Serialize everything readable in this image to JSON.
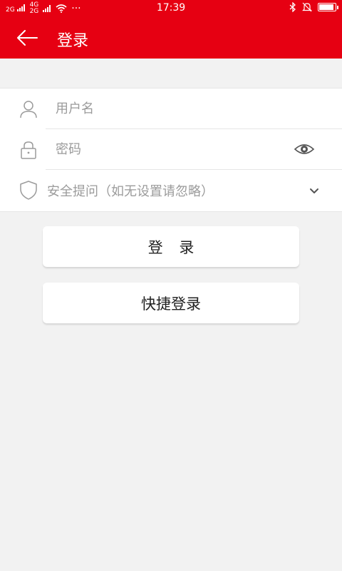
{
  "status_bar": {
    "network_1": "2G",
    "network_2": "4G",
    "network_3": "2G",
    "dots": "···",
    "time": "17:39",
    "icons": [
      "signal-icon",
      "wifi-icon",
      "bluetooth-icon",
      "mute-icon",
      "battery-icon"
    ]
  },
  "app_bar": {
    "title": "登录",
    "back_icon": "arrow-left-icon",
    "background_color": "#e60012"
  },
  "form": {
    "username": {
      "placeholder": "用户名",
      "value": "",
      "icon": "user-icon"
    },
    "password": {
      "placeholder": "密码",
      "value": "",
      "icon": "lock-icon",
      "toggle_icon": "eye-icon"
    },
    "security_question": {
      "label": "安全提问（如无设置请忽略）",
      "icon": "shield-icon",
      "dropdown_icon": "chevron-down-icon"
    }
  },
  "buttons": {
    "login": "登 录",
    "quick_login": "快捷登录"
  }
}
